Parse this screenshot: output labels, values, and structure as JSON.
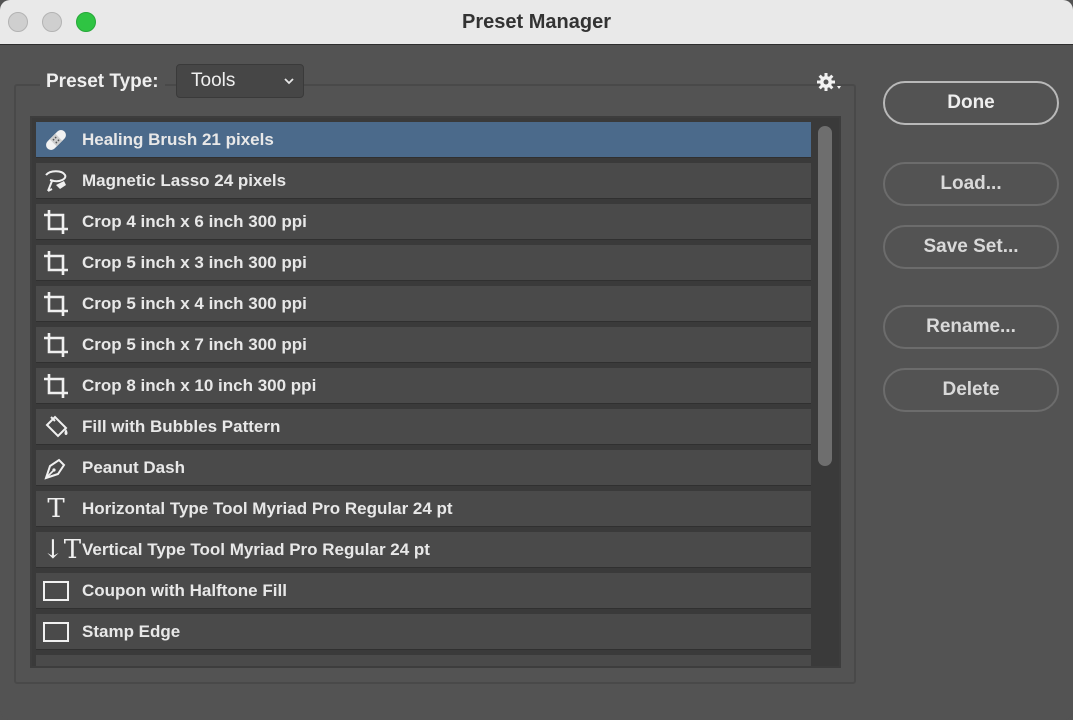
{
  "window": {
    "title": "Preset Manager"
  },
  "preset_type": {
    "label": "Preset Type:",
    "selected": "Tools"
  },
  "menu_icon": "gear-icon",
  "list": {
    "items": [
      {
        "label": "Healing Brush 21 pixels",
        "icon": "bandage-icon",
        "selected": true
      },
      {
        "label": "Magnetic Lasso 24 pixels",
        "icon": "magnetic-lasso-icon"
      },
      {
        "label": "Crop 4 inch x 6 inch 300 ppi",
        "icon": "crop-icon"
      },
      {
        "label": "Crop 5 inch x 3 inch 300 ppi",
        "icon": "crop-icon"
      },
      {
        "label": "Crop 5 inch x 4 inch 300 ppi",
        "icon": "crop-icon"
      },
      {
        "label": "Crop 5 inch x 7 inch 300 ppi",
        "icon": "crop-icon"
      },
      {
        "label": "Crop 8 inch x 10 inch 300 ppi",
        "icon": "crop-icon"
      },
      {
        "label": "Fill with Bubbles Pattern",
        "icon": "paint-bucket-icon"
      },
      {
        "label": "Peanut Dash",
        "icon": "pen-icon"
      },
      {
        "label": "Horizontal Type Tool Myriad Pro Regular 24 pt",
        "icon": "type-icon",
        "glyph": "T"
      },
      {
        "label": "Vertical Type Tool Myriad Pro Regular 24 pt",
        "icon": "vertical-type-icon",
        "glyph": "↓T"
      },
      {
        "label": "Coupon with Halftone Fill",
        "icon": "rectangle-icon"
      },
      {
        "label": "Stamp Edge",
        "icon": "rectangle-icon"
      }
    ]
  },
  "buttons": {
    "done": "Done",
    "load": "Load...",
    "save_set": "Save Set...",
    "rename": "Rename...",
    "delete": "Delete"
  },
  "colors": {
    "selection": "#4b6a8b",
    "zoom_button": "#2fc443"
  }
}
